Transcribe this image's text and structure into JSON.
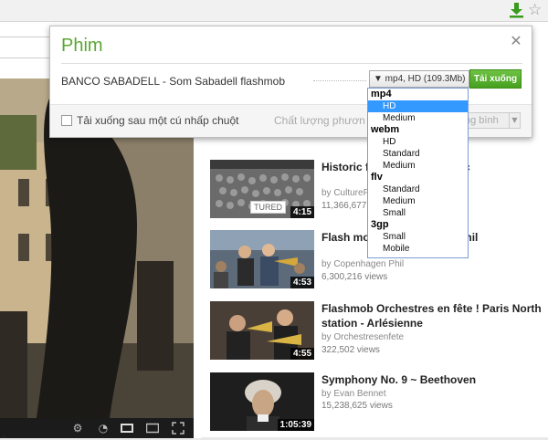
{
  "popup": {
    "title": "Phim",
    "video_name": "BANCO SABADELL - Som Sabadell flashmob",
    "selected_format": "▼ mp4, HD (109.3Mb)",
    "download_button": "Tải xuống",
    "one_click_label": "Tải xuống sau một cú nhấp chuột",
    "quality_label": "Chất lượng phươn",
    "quality_value": "ng bình"
  },
  "dropdown": {
    "groups": [
      {
        "label": "mp4",
        "options": [
          "HD",
          "Medium"
        ]
      },
      {
        "label": "webm",
        "options": [
          "HD",
          "Standard",
          "Medium"
        ]
      },
      {
        "label": "flv",
        "options": [
          "Standard",
          "Medium",
          "Small"
        ]
      },
      {
        "label": "3gp",
        "options": [
          "Small",
          "Mobile"
        ]
      }
    ],
    "selected": "mp4/HD"
  },
  "videos": [
    {
      "title": "Historic f... rp train station, c",
      "by": "by CultureF...",
      "views": "11,366,677",
      "duration": "4:15",
      "badge": "TURED"
    },
    {
      "title": "Flash mo... Central S... en Phil",
      "by": "by Copenhagen Phil",
      "views": "6,300,216 views",
      "duration": "4:53"
    },
    {
      "title": "Flashmob Orchestres en fête ! Paris North station - Arlésienne",
      "by": "by Orchestresenfete",
      "views": "322,502 views",
      "duration": "4:55"
    },
    {
      "title": "Symphony No. 9 ~ Beethoven",
      "by": "by Evan Bennet",
      "views": "15,238,625 views",
      "duration": "1:05:39"
    }
  ],
  "colors": {
    "accent_green": "#5aa632",
    "select_blue": "#3399ff"
  },
  "icons": [
    "download-icon",
    "star-icon",
    "close-icon",
    "gear-icon",
    "clock-icon",
    "screen-icon",
    "fullscreen-icon"
  ]
}
